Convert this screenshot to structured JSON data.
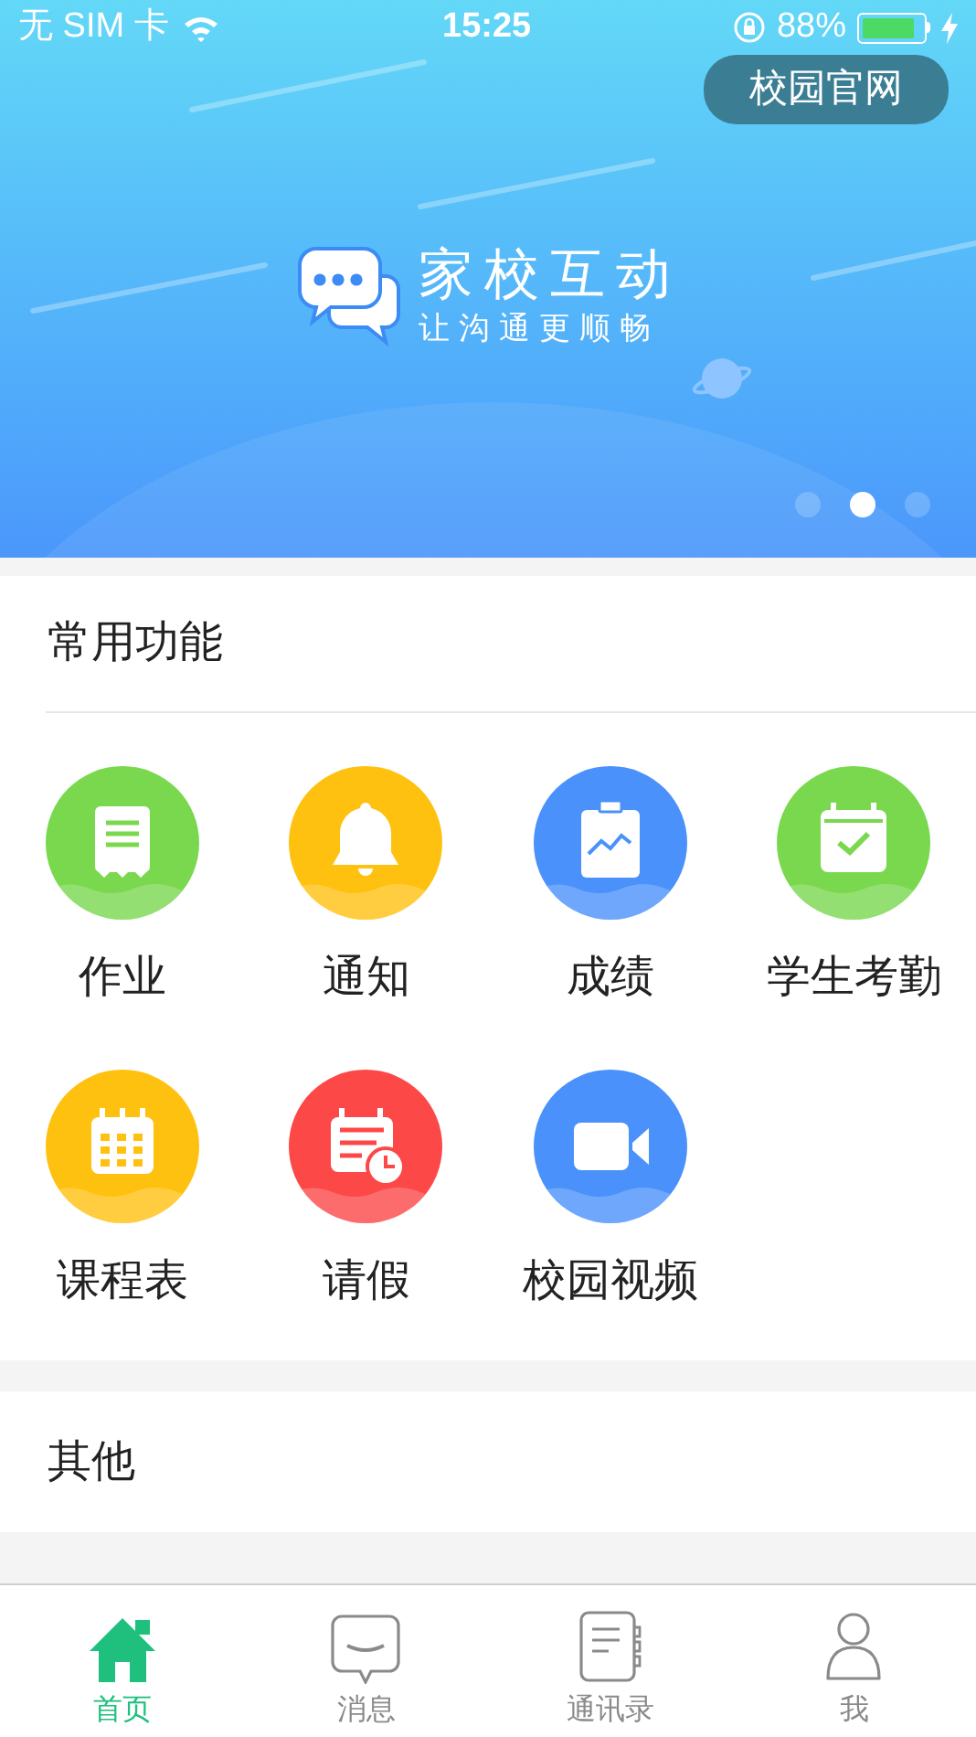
{
  "status_bar": {
    "carrier": "无 SIM 卡",
    "time": "15:25",
    "battery": "88%"
  },
  "banner": {
    "site_button": "校园官网",
    "title": "家校互动",
    "subtitle": "让沟通更顺畅",
    "dots": [
      {
        "selected": false
      },
      {
        "selected": true
      },
      {
        "selected": false
      }
    ]
  },
  "section_common": {
    "title": "常用功能",
    "items": [
      {
        "label": "作业",
        "kind": "homework",
        "color": "#7ad84e"
      },
      {
        "label": "通知",
        "kind": "bell",
        "color": "#ffc110"
      },
      {
        "label": "成绩",
        "kind": "chart",
        "color": "#4a91fb"
      },
      {
        "label": "学生考勤",
        "kind": "attendance",
        "color": "#7ad84e"
      },
      {
        "label": "课程表",
        "kind": "calendar",
        "color": "#ffc110"
      },
      {
        "label": "请假",
        "kind": "leave",
        "color": "#fd4848"
      },
      {
        "label": "校园视频",
        "kind": "video",
        "color": "#4a91fb"
      }
    ]
  },
  "section_other": {
    "title": "其他"
  },
  "tab_bar": [
    {
      "label": "首页",
      "kind": "home",
      "selected": true
    },
    {
      "label": "消息",
      "kind": "message",
      "selected": false
    },
    {
      "label": "通讯录",
      "kind": "contacts",
      "selected": false
    },
    {
      "label": "我",
      "kind": "me",
      "selected": false
    }
  ]
}
